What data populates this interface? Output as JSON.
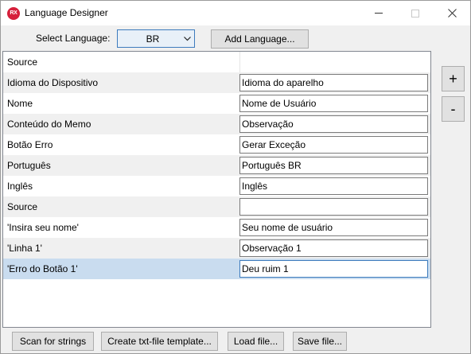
{
  "window": {
    "app_icon_text": "RX",
    "title": "Language Designer"
  },
  "toolbar": {
    "select_language_label": "Select Language:",
    "selected_language": "BR",
    "add_language_label": "Add Language..."
  },
  "grid": {
    "rows": [
      {
        "source": "Source",
        "target": ""
      },
      {
        "source": "Idioma do Dispositivo",
        "target": "Idioma do aparelho"
      },
      {
        "source": "Nome",
        "target": "Nome de Usuário"
      },
      {
        "source": "Conteúdo do Memo",
        "target": "Observação"
      },
      {
        "source": "Botão Erro",
        "target": "Gerar Exceção"
      },
      {
        "source": "Português",
        "target": "Português BR"
      },
      {
        "source": "Inglês",
        "target": "Inglês"
      },
      {
        "source": "Source",
        "target": ""
      },
      {
        "source": "'Insira seu nome'",
        "target": "Seu nome de usuário"
      },
      {
        "source": "'Linha 1'",
        "target": "Observação 1"
      },
      {
        "source": "'Erro do Botão 1'",
        "target": "Deu ruim 1"
      }
    ]
  },
  "side_buttons": {
    "plus": "+",
    "minus": "-"
  },
  "footer": {
    "scan_label": "Scan for strings",
    "template_label": "Create txt-file template...",
    "load_label": "Load file...",
    "save_label": "Save file..."
  },
  "colors": {
    "accent": "#3d7bbd",
    "selected_row": "#c9dcef",
    "alt_row": "#f0f0f0"
  }
}
